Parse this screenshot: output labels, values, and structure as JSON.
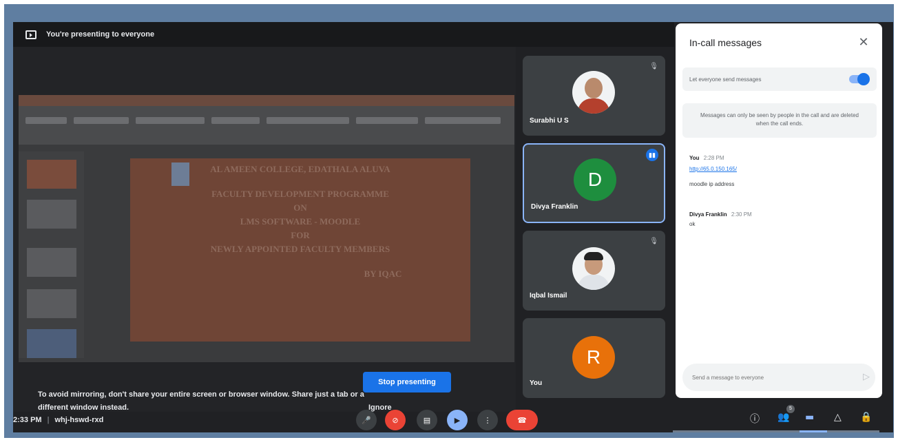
{
  "banner": {
    "text": "You're presenting to everyone",
    "icon": "present-to-all-icon"
  },
  "slide": {
    "title_lines": [
      "AL AMEEN COLLEGE, EDATHALA ALUVA",
      "FACULTY DEVELOPMENT PROGRAMME",
      "ON",
      "LMS SOFTWARE - MOODLE",
      "FOR",
      "NEWLY APPOINTED FACULTY MEMBERS",
      "BY IQAC"
    ]
  },
  "presenting": {
    "tip": "To avoid mirroring, don't share your entire screen or browser window. Share just a tab or a different window instead.",
    "stop_label": "Stop presenting",
    "ignore_label": "Ignore"
  },
  "participants": [
    {
      "name": "Surabhi U S",
      "kind": "photo",
      "muted": true
    },
    {
      "name": "Divya Franklin",
      "kind": "initial",
      "initial": "D",
      "color": "#1e8e3e",
      "speaking": true
    },
    {
      "name": "Iqbal Ismail",
      "kind": "photo",
      "muted": true
    },
    {
      "name": "You",
      "kind": "initial",
      "initial": "R",
      "color": "#e8710a"
    }
  ],
  "chat": {
    "title": "In-call messages",
    "toggle_label": "Let everyone send messages",
    "toggle_on": true,
    "notice": "Messages can only be seen by people in the call and are deleted when the call ends.",
    "messages": [
      {
        "sender": "You",
        "time": "2:28 PM",
        "link": "http://65.0.150.165/",
        "text": "moodle ip address"
      },
      {
        "sender": "Divya Franklin",
        "time": "2:30 PM",
        "text": "ok"
      }
    ],
    "placeholder": "Send a message to everyone"
  },
  "meeting": {
    "time": "2:33 PM",
    "code": "whj-hswd-rxd"
  },
  "people_count": "5",
  "colors": {
    "accent": "#1a73e8",
    "end_call": "#ea4335",
    "dark_bg": "#202124"
  }
}
